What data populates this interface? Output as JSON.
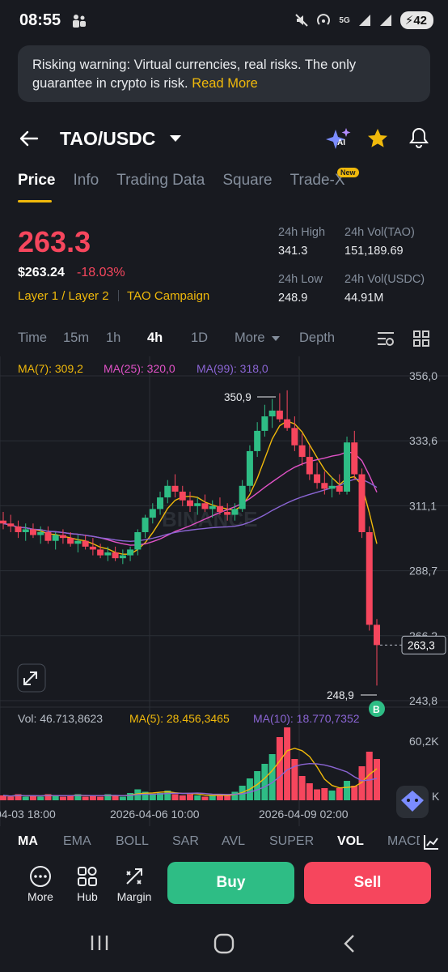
{
  "status": {
    "time": "08:55",
    "battery": "42",
    "net": "5G"
  },
  "warning": {
    "text": "Risking warning: Virtual currencies, real risks. The only guarantee in crypto is risk.",
    "link": "Read More"
  },
  "header": {
    "pair": "TAO/USDC",
    "ai_label": "AI"
  },
  "tabs": [
    {
      "label": "Price",
      "active": true
    },
    {
      "label": "Info"
    },
    {
      "label": "Trading Data"
    },
    {
      "label": "Square"
    },
    {
      "label": "Trade-X",
      "badge": "New"
    }
  ],
  "ticker": {
    "last_price": "263.3",
    "usd_price": "$263.24",
    "change": "-18.03%",
    "tag1": "Layer 1 / Layer 2",
    "tag2": "TAO Campaign",
    "high_label": "24h High",
    "high": "341.3",
    "low_label": "24h Low",
    "low": "248.9",
    "vol_tao_label": "24h Vol(TAO)",
    "vol_tao": "151,189.69",
    "vol_usdc_label": "24h Vol(USDC)",
    "vol_usdc": "44.91M"
  },
  "timeframes": [
    "Time",
    "15m",
    "1h",
    "4h",
    "1D",
    "More",
    "Depth"
  ],
  "active_timeframe": "4h",
  "indicators": {
    "ma7": "MA(7): 309,2",
    "ma25": "MA(25): 320,0",
    "ma99": "MA(99): 318,0",
    "vol": "Vol: 46.713,8623",
    "vol_ma5": "MA(5): 28.456,3465",
    "vol_ma10": "MA(10): 18.770,7352"
  },
  "colors": {
    "up": "#2ebd85",
    "down": "#f6465d",
    "ma7": "#f0b90b",
    "ma25": "#e052c6",
    "ma99": "#8b65d4",
    "accent": "#f0b90b"
  },
  "chart_data": {
    "type": "candlestick",
    "y_ticks": [
      "356,0",
      "333,6",
      "311,1",
      "288,7",
      "266,2",
      "243,8"
    ],
    "y_range": [
      243.8,
      356.0
    ],
    "x_labels": [
      "04-03 18:00",
      "2026-04-06 10:00",
      "2026-04-09 02:00"
    ],
    "last_price_label": "263,3",
    "high_marker": "350,9",
    "low_marker": "248,9",
    "marker_b": "B",
    "vol_ticks": [
      "60,2K",
      "K"
    ],
    "candles": [
      [
        306,
        309,
        303,
        305
      ],
      [
        305,
        308,
        302,
        304
      ],
      [
        304,
        306,
        300,
        302
      ],
      [
        302,
        305,
        299,
        303
      ],
      [
        303,
        305,
        300,
        301
      ],
      [
        301,
        304,
        298,
        302
      ],
      [
        302,
        304,
        298,
        299
      ],
      [
        299,
        302,
        296,
        301
      ],
      [
        301,
        303,
        298,
        300
      ],
      [
        300,
        302,
        297,
        298
      ],
      [
        298,
        301,
        295,
        299
      ],
      [
        299,
        301,
        296,
        297
      ],
      [
        297,
        300,
        294,
        296
      ],
      [
        296,
        298,
        293,
        294
      ],
      [
        294,
        297,
        292,
        295
      ],
      [
        295,
        297,
        292,
        293
      ],
      [
        293,
        296,
        291,
        294
      ],
      [
        294,
        297,
        292,
        296
      ],
      [
        296,
        303,
        294,
        302
      ],
      [
        302,
        308,
        300,
        307
      ],
      [
        307,
        312,
        305,
        310
      ],
      [
        310,
        316,
        308,
        314
      ],
      [
        314,
        320,
        312,
        318
      ],
      [
        318,
        322,
        314,
        316
      ],
      [
        316,
        318,
        311,
        313
      ],
      [
        313,
        316,
        309,
        311
      ],
      [
        311,
        314,
        308,
        312
      ],
      [
        312,
        315,
        309,
        310
      ],
      [
        310,
        313,
        307,
        311
      ],
      [
        311,
        314,
        308,
        309
      ],
      [
        309,
        312,
        306,
        308
      ],
      [
        308,
        312,
        306,
        310
      ],
      [
        310,
        320,
        309,
        318
      ],
      [
        318,
        332,
        316,
        330
      ],
      [
        330,
        340,
        328,
        337
      ],
      [
        337,
        346,
        335,
        342
      ],
      [
        342,
        348,
        338,
        344
      ],
      [
        344,
        350,
        340,
        341
      ],
      [
        341,
        351,
        337,
        338
      ],
      [
        338,
        342,
        330,
        332
      ],
      [
        332,
        336,
        325,
        328
      ],
      [
        328,
        332,
        320,
        322
      ],
      [
        322,
        326,
        317,
        319
      ],
      [
        319,
        323,
        315,
        317
      ],
      [
        317,
        321,
        314,
        318
      ],
      [
        318,
        322,
        315,
        316
      ],
      [
        316,
        335,
        315,
        333
      ],
      [
        333,
        337,
        320,
        322
      ],
      [
        322,
        324,
        300,
        302
      ],
      [
        302,
        304,
        268,
        270
      ],
      [
        270,
        272,
        249,
        263
      ]
    ],
    "volumes": [
      4,
      3,
      5,
      3,
      4,
      3,
      5,
      4,
      3,
      4,
      5,
      3,
      4,
      3,
      5,
      4,
      3,
      6,
      9,
      7,
      5,
      6,
      8,
      5,
      4,
      5,
      4,
      3,
      4,
      5,
      4,
      7,
      12,
      18,
      24,
      30,
      38,
      52,
      60,
      34,
      20,
      14,
      9,
      10,
      8,
      10,
      16,
      12,
      28,
      40,
      34
    ]
  },
  "bottom_tabs": [
    "MA",
    "EMA",
    "BOLL",
    "SAR",
    "AVL",
    "SUPER",
    "VOL",
    "MACD"
  ],
  "active_bottom_tab": "VOL",
  "actions": {
    "more": "More",
    "hub": "Hub",
    "margin": "Margin",
    "buy": "Buy",
    "sell": "Sell"
  },
  "watermark": "BINANCE"
}
